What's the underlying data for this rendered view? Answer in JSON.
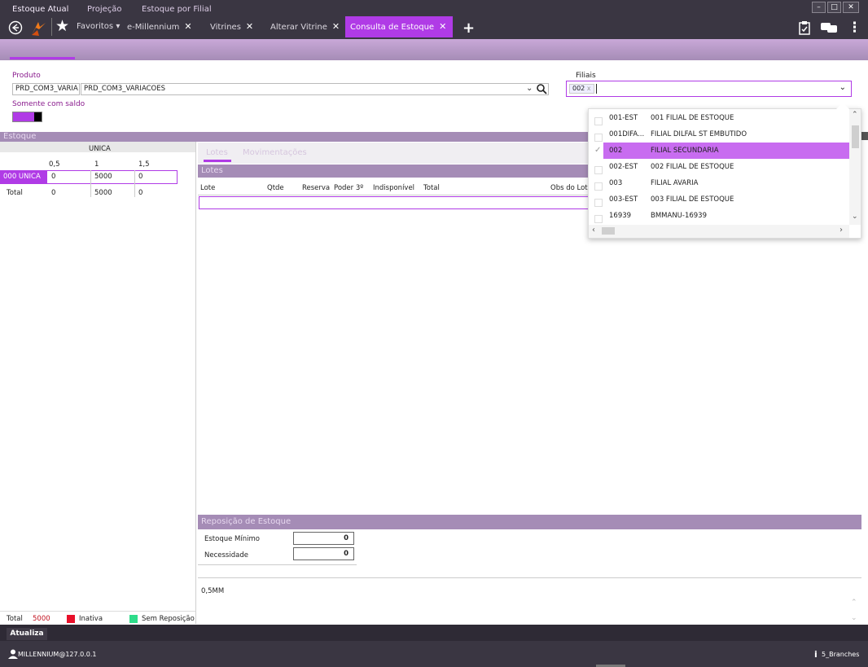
{
  "tabs": {
    "favoritos": "Favoritos",
    "items": [
      {
        "label": "e-Millennium"
      },
      {
        "label": "Vitrines"
      },
      {
        "label": "Alterar Vitrine"
      },
      {
        "label": "Consulta de Estoque"
      }
    ]
  },
  "subtabs": [
    "Estoque Atual",
    "Projeção",
    "Estoque por Filial"
  ],
  "produto": {
    "label": "Produto",
    "code": "PRD_COM3_VARIA",
    "name": "PRD_COM3_VARIACOES"
  },
  "somente_com_saldo": "Somente com saldo",
  "filiais": {
    "label": "Filiais",
    "selected_chip": "002",
    "options": [
      {
        "code": "001-EST",
        "name": "001 FILIAL DE ESTOQUE",
        "checked": false
      },
      {
        "code": "001DIFA...",
        "name": "FILIAL DILFAL ST EMBUTIDO",
        "checked": false
      },
      {
        "code": "002",
        "name": "FILIAL SECUNDARIA",
        "checked": true
      },
      {
        "code": "002-EST",
        "name": "002 FILIAL DE ESTOQUE",
        "checked": false
      },
      {
        "code": "003",
        "name": "FILIAL AVARIA",
        "checked": false
      },
      {
        "code": "003-EST",
        "name": "003 FILIAL DE ESTOQUE",
        "checked": false
      },
      {
        "code": "16939",
        "name": "BMMANU-16939",
        "checked": false
      }
    ]
  },
  "estoque": {
    "title": "Estoque",
    "header": "UNICA",
    "sizes": [
      "0,5",
      "1",
      "1,5"
    ],
    "rows": [
      {
        "label": "000 UNICA",
        "values": [
          "0",
          "5000",
          "0"
        ]
      },
      {
        "label": "Total",
        "values": [
          "0",
          "5000",
          "0"
        ]
      }
    ]
  },
  "lotes": {
    "tabs": [
      "Lotes",
      "Movimentações"
    ],
    "section": "Lotes",
    "columns": [
      "Lote",
      "Qtde",
      "Reserva",
      "Poder 3º",
      "Indisponível",
      "Total",
      "Obs do Lot"
    ]
  },
  "reposicao": {
    "title": "Reposição de Estoque",
    "minimo_label": "Estoque Mínimo",
    "minimo_value": "0",
    "necessidade_label": "Necessidade",
    "necessidade_value": "0"
  },
  "notes": "0,5MM",
  "legend": {
    "total_label": "Total",
    "total_value": "5000",
    "inativa": "Inativa",
    "sem_reposicao": "Sem Reposição"
  },
  "atualiza_button": "Atualiza",
  "status": {
    "user": "MILLENNIUM@127.0.0.1",
    "branches": "5_Branches"
  },
  "colors": {
    "accent": "#b03be6",
    "topbar": "#3a3642",
    "section": "#a58cb6",
    "inativa": "#e8102a",
    "sem_reposicao": "#2edc8a"
  }
}
